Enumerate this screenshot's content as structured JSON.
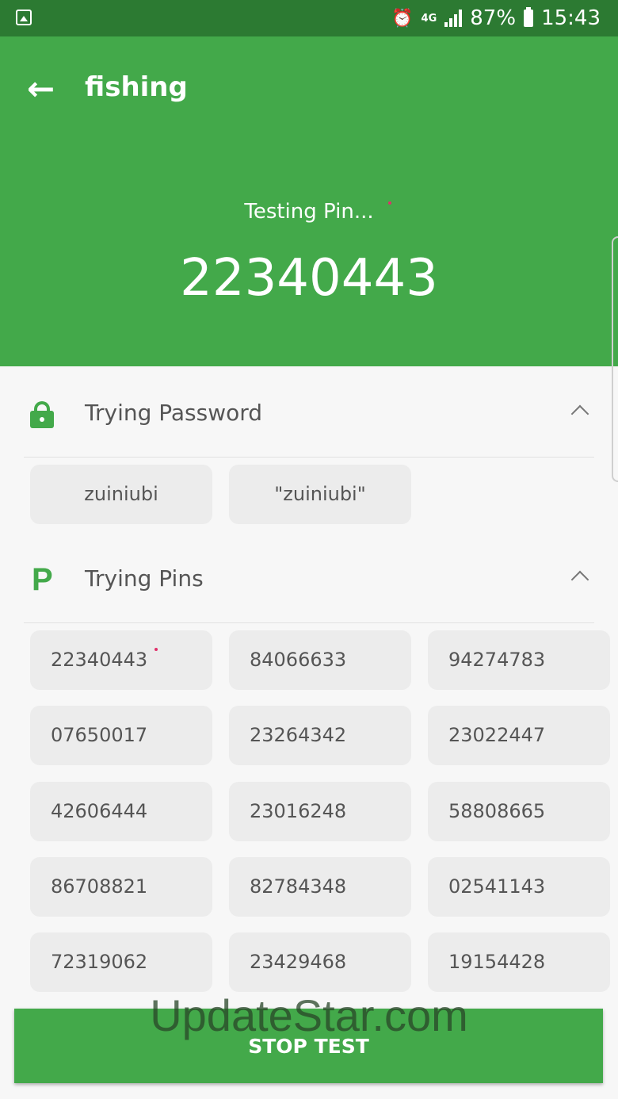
{
  "status_bar": {
    "battery": "87%",
    "time": "15:43",
    "network": "4G",
    "icons": [
      "gallery-icon",
      "alarm-icon",
      "signal-icon",
      "battery-icon"
    ]
  },
  "header": {
    "title": "fishing",
    "testing_label": "Testing Pin...",
    "current_pin": "22340443"
  },
  "password_section": {
    "title": "Trying Password",
    "items": [
      "zuiniubi",
      "\"zuiniubi\""
    ]
  },
  "pins_section": {
    "title": "Trying Pins",
    "items": [
      "22340443",
      "84066633",
      "94274783",
      "07650017",
      "23264342",
      "23022447",
      "42606444",
      "23016248",
      "58808665",
      "86708821",
      "82784348",
      "02541143",
      "72319062",
      "23429468",
      "19154428"
    ]
  },
  "stop_button": "STOP TEST",
  "watermark": "UpdateStar.com",
  "colors": {
    "primary": "#43a94a",
    "status_bar": "#2c7a32",
    "chip": "#ececec"
  }
}
